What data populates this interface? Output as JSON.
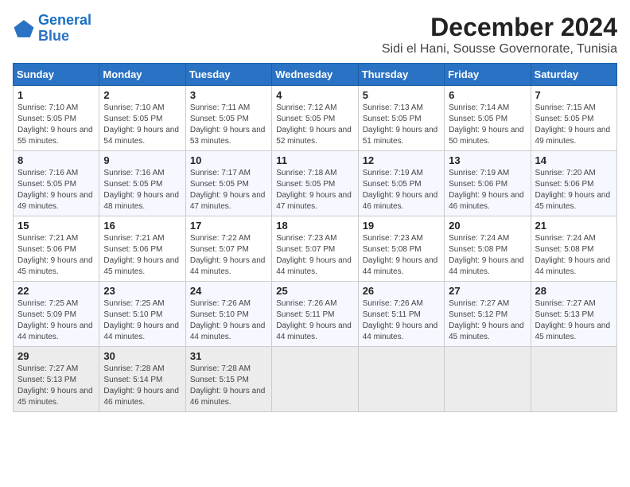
{
  "logo": {
    "text_general": "General",
    "text_blue": "Blue"
  },
  "header": {
    "month_year": "December 2024",
    "location": "Sidi el Hani, Sousse Governorate, Tunisia"
  },
  "weekdays": [
    "Sunday",
    "Monday",
    "Tuesday",
    "Wednesday",
    "Thursday",
    "Friday",
    "Saturday"
  ],
  "weeks": [
    [
      {
        "day": "1",
        "sunrise": "Sunrise: 7:10 AM",
        "sunset": "Sunset: 5:05 PM",
        "daylight": "Daylight: 9 hours and 55 minutes."
      },
      {
        "day": "2",
        "sunrise": "Sunrise: 7:10 AM",
        "sunset": "Sunset: 5:05 PM",
        "daylight": "Daylight: 9 hours and 54 minutes."
      },
      {
        "day": "3",
        "sunrise": "Sunrise: 7:11 AM",
        "sunset": "Sunset: 5:05 PM",
        "daylight": "Daylight: 9 hours and 53 minutes."
      },
      {
        "day": "4",
        "sunrise": "Sunrise: 7:12 AM",
        "sunset": "Sunset: 5:05 PM",
        "daylight": "Daylight: 9 hours and 52 minutes."
      },
      {
        "day": "5",
        "sunrise": "Sunrise: 7:13 AM",
        "sunset": "Sunset: 5:05 PM",
        "daylight": "Daylight: 9 hours and 51 minutes."
      },
      {
        "day": "6",
        "sunrise": "Sunrise: 7:14 AM",
        "sunset": "Sunset: 5:05 PM",
        "daylight": "Daylight: 9 hours and 50 minutes."
      },
      {
        "day": "7",
        "sunrise": "Sunrise: 7:15 AM",
        "sunset": "Sunset: 5:05 PM",
        "daylight": "Daylight: 9 hours and 49 minutes."
      }
    ],
    [
      {
        "day": "8",
        "sunrise": "Sunrise: 7:16 AM",
        "sunset": "Sunset: 5:05 PM",
        "daylight": "Daylight: 9 hours and 49 minutes."
      },
      {
        "day": "9",
        "sunrise": "Sunrise: 7:16 AM",
        "sunset": "Sunset: 5:05 PM",
        "daylight": "Daylight: 9 hours and 48 minutes."
      },
      {
        "day": "10",
        "sunrise": "Sunrise: 7:17 AM",
        "sunset": "Sunset: 5:05 PM",
        "daylight": "Daylight: 9 hours and 47 minutes."
      },
      {
        "day": "11",
        "sunrise": "Sunrise: 7:18 AM",
        "sunset": "Sunset: 5:05 PM",
        "daylight": "Daylight: 9 hours and 47 minutes."
      },
      {
        "day": "12",
        "sunrise": "Sunrise: 7:19 AM",
        "sunset": "Sunset: 5:05 PM",
        "daylight": "Daylight: 9 hours and 46 minutes."
      },
      {
        "day": "13",
        "sunrise": "Sunrise: 7:19 AM",
        "sunset": "Sunset: 5:06 PM",
        "daylight": "Daylight: 9 hours and 46 minutes."
      },
      {
        "day": "14",
        "sunrise": "Sunrise: 7:20 AM",
        "sunset": "Sunset: 5:06 PM",
        "daylight": "Daylight: 9 hours and 45 minutes."
      }
    ],
    [
      {
        "day": "15",
        "sunrise": "Sunrise: 7:21 AM",
        "sunset": "Sunset: 5:06 PM",
        "daylight": "Daylight: 9 hours and 45 minutes."
      },
      {
        "day": "16",
        "sunrise": "Sunrise: 7:21 AM",
        "sunset": "Sunset: 5:06 PM",
        "daylight": "Daylight: 9 hours and 45 minutes."
      },
      {
        "day": "17",
        "sunrise": "Sunrise: 7:22 AM",
        "sunset": "Sunset: 5:07 PM",
        "daylight": "Daylight: 9 hours and 44 minutes."
      },
      {
        "day": "18",
        "sunrise": "Sunrise: 7:23 AM",
        "sunset": "Sunset: 5:07 PM",
        "daylight": "Daylight: 9 hours and 44 minutes."
      },
      {
        "day": "19",
        "sunrise": "Sunrise: 7:23 AM",
        "sunset": "Sunset: 5:08 PM",
        "daylight": "Daylight: 9 hours and 44 minutes."
      },
      {
        "day": "20",
        "sunrise": "Sunrise: 7:24 AM",
        "sunset": "Sunset: 5:08 PM",
        "daylight": "Daylight: 9 hours and 44 minutes."
      },
      {
        "day": "21",
        "sunrise": "Sunrise: 7:24 AM",
        "sunset": "Sunset: 5:08 PM",
        "daylight": "Daylight: 9 hours and 44 minutes."
      }
    ],
    [
      {
        "day": "22",
        "sunrise": "Sunrise: 7:25 AM",
        "sunset": "Sunset: 5:09 PM",
        "daylight": "Daylight: 9 hours and 44 minutes."
      },
      {
        "day": "23",
        "sunrise": "Sunrise: 7:25 AM",
        "sunset": "Sunset: 5:10 PM",
        "daylight": "Daylight: 9 hours and 44 minutes."
      },
      {
        "day": "24",
        "sunrise": "Sunrise: 7:26 AM",
        "sunset": "Sunset: 5:10 PM",
        "daylight": "Daylight: 9 hours and 44 minutes."
      },
      {
        "day": "25",
        "sunrise": "Sunrise: 7:26 AM",
        "sunset": "Sunset: 5:11 PM",
        "daylight": "Daylight: 9 hours and 44 minutes."
      },
      {
        "day": "26",
        "sunrise": "Sunrise: 7:26 AM",
        "sunset": "Sunset: 5:11 PM",
        "daylight": "Daylight: 9 hours and 44 minutes."
      },
      {
        "day": "27",
        "sunrise": "Sunrise: 7:27 AM",
        "sunset": "Sunset: 5:12 PM",
        "daylight": "Daylight: 9 hours and 45 minutes."
      },
      {
        "day": "28",
        "sunrise": "Sunrise: 7:27 AM",
        "sunset": "Sunset: 5:13 PM",
        "daylight": "Daylight: 9 hours and 45 minutes."
      }
    ],
    [
      {
        "day": "29",
        "sunrise": "Sunrise: 7:27 AM",
        "sunset": "Sunset: 5:13 PM",
        "daylight": "Daylight: 9 hours and 45 minutes."
      },
      {
        "day": "30",
        "sunrise": "Sunrise: 7:28 AM",
        "sunset": "Sunset: 5:14 PM",
        "daylight": "Daylight: 9 hours and 46 minutes."
      },
      {
        "day": "31",
        "sunrise": "Sunrise: 7:28 AM",
        "sunset": "Sunset: 5:15 PM",
        "daylight": "Daylight: 9 hours and 46 minutes."
      },
      null,
      null,
      null,
      null
    ]
  ]
}
